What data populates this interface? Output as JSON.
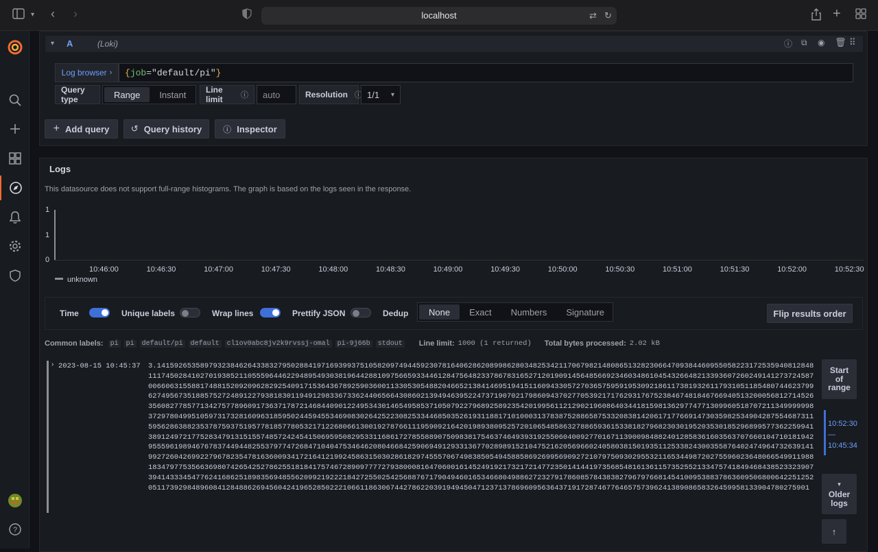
{
  "browser": {
    "url": "localhost",
    "icons": [
      "sidebar-toggle-icon",
      "chevron-down-icon",
      "back-icon",
      "forward-icon",
      "shield-icon",
      "translate-icon",
      "reload-icon",
      "share-icon",
      "new-tab-icon",
      "tabs-overview-icon"
    ]
  },
  "sidebar": {
    "items": [
      "grafana-logo",
      "search-icon",
      "plus-icon",
      "dashboards-icon",
      "explore-icon",
      "alerting-icon",
      "configuration-icon",
      "server-admin-icon",
      "user-avatar",
      "help-icon"
    ],
    "active": "explore-icon",
    "accent": "#f46a2e"
  },
  "query": {
    "ref_id": "A",
    "datasource": "(Loki)",
    "log_browser": "Log browser",
    "expression_key": "job",
    "expression_value": "\"default/pi\"",
    "query_type_label": "Query type",
    "query_type_options": [
      "Range",
      "Instant"
    ],
    "query_type_selected": "Range",
    "line_limit_label": "Line limit",
    "line_limit_placeholder": "auto",
    "resolution_label": "Resolution",
    "resolution_value": "1/1"
  },
  "actions": {
    "add_query": "Add query",
    "query_history": "Query history",
    "inspector": "Inspector"
  },
  "logs": {
    "title": "Logs",
    "notice": "This datasource does not support full-range histograms. The graph is based on the logs seen in the response.",
    "y_ticks": [
      "1",
      "1",
      "0"
    ],
    "x_ticks": [
      "10:46:00",
      "10:46:30",
      "10:47:00",
      "10:47:30",
      "10:48:00",
      "10:48:30",
      "10:49:00",
      "10:49:30",
      "10:50:00",
      "10:50:30",
      "10:51:00",
      "10:51:30",
      "10:52:00",
      "10:52:30"
    ],
    "legend": "unknown",
    "options": {
      "time": "Time",
      "unique_labels": "Unique labels",
      "wrap_lines": "Wrap lines",
      "prettify_json": "Prettify JSON",
      "dedup": "Dedup",
      "dedup_options": [
        "None",
        "Exact",
        "Numbers",
        "Signature"
      ],
      "dedup_selected": "None",
      "flip": "Flip results order",
      "toggles": {
        "time": true,
        "unique_labels": false,
        "wrap_lines": true,
        "prettify_json": false
      }
    },
    "common_labels_title": "Common labels:",
    "common_labels": [
      "pi",
      "pi",
      "default/pi",
      "default",
      "cl1ov0abc8jv2k9rvssj-omal",
      "pi-9j66b",
      "stdout"
    ],
    "line_limit_info": "Line limit:",
    "line_limit_value": "1000 (1 returned)",
    "bytes_label": "Total bytes processed:",
    "bytes_value": "2.02 kB",
    "row_timestamp": "2023-08-15 10:45:37",
    "row_message": "3.1415926535897932384626433832795028841971693993751058209749445923078164062862089986280348253421170679821480865132823066470938446095505822317253594081284811174502841027019385211055596446229489549303819644288109756659334461284756482337867831652712019091456485669234603486104543266482133936072602491412737245870066063155881748815209209628292540917153643678925903600113305305488204665213841469519415116094330572703657595919530921861173819326117931051185480744623799627495673518857527248912279381830119491298336733624406566430860213949463952247371907021798609437027705392171762931767523846748184676694051320005681271452635608277857713427577896091736371787214684409012249534301465495853710507922796892589235420199561121290219608640344181598136297747713099605187072113499999983729780499510597317328160963185950244594553469083026425223082533446850352619311881710100031378387528865875332083814206171776691473035982534904287554687311595628638823537875937519577818577805321712268066130019278766111959092164201989380952572010654858632788659361533818279682303019520353018529689957736225994138912497217752834791315155748572424541506959508295331168617278558890750983817546374649393192550604009277016711390098488240128583616035637076601047101819429555961989467678374494482553797747268471040475346462080466842590694912933136770289891521047521620569660240580381501935112533824300355876402474964732639141992726042699227967823547816360093417216412199245863150302861829745557067498385054945885869269956909272107975093029553211653449872027559602364806654991198818347977535663698074265425278625518184175746728909777727938000816470600161452491921732172147723501414419735685481613611573525521334757418494684385233239073941433345477624168625189835694855620992192221842725502542568876717904946016534668049886272327917860857843838279679766814541009538837863609506800642251252051173929848960841284886269456042419652850222106611863067442786220391949450471237137869609563643719172874677646575739624138908658326459958133904780275901"
  },
  "nav_panel": {
    "start_of_range": "Start of range",
    "range_end": "10:52:30",
    "range_sep": "—",
    "range_start": "10:45:34",
    "older_logs": "Older logs"
  }
}
